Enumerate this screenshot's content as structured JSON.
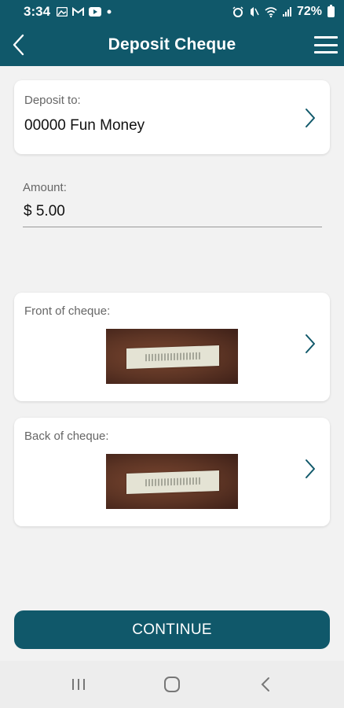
{
  "status_bar": {
    "time": "3:34",
    "battery_percent": "72%",
    "left_icons": [
      "gallery-icon",
      "gmail-icon",
      "youtube-icon",
      "dot-icon"
    ],
    "right_icons": [
      "alarm-icon",
      "mute-icon",
      "wifi-icon",
      "signal-icon",
      "battery-icon"
    ]
  },
  "header": {
    "title": "Deposit Cheque",
    "back_icon": "chevron-left-icon",
    "menu_icon": "hamburger-menu-icon"
  },
  "deposit_to": {
    "label": "Deposit to:",
    "value": "00000 Fun Money"
  },
  "amount": {
    "label": "Amount:",
    "value": "$ 5.00"
  },
  "front_cheque": {
    "label": "Front of cheque:"
  },
  "back_cheque": {
    "label": "Back of cheque:"
  },
  "continue_label": "CONTINUE",
  "nav": {
    "icons": [
      "recent-apps-icon",
      "home-icon",
      "back-icon"
    ]
  },
  "colors": {
    "brand": "#10586a",
    "background": "#f2f2f2",
    "card": "#ffffff"
  }
}
